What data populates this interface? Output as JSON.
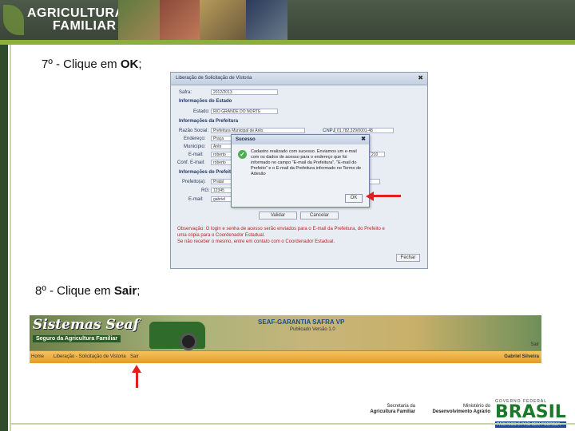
{
  "header": {
    "logo_line1": "AGRICULTURA",
    "logo_line2": "FAMILIAR"
  },
  "steps": [
    {
      "prefix": "7º - Clique em ",
      "action": "OK",
      "suffix": ";"
    },
    {
      "prefix": "8º - Clique em ",
      "action": "Sair",
      "suffix": ";"
    }
  ],
  "screenshot1": {
    "window_title": "Liberação de Solicitação de Vistoria",
    "safra_label": "Safra:",
    "safra_value": "2012/2013",
    "section_estado": "Informações do Estado",
    "estado_label": "Estado:",
    "estado_value": "RIO GRANDE DO NORTE",
    "section_prefeitura": "Informações da Prefeitura",
    "razao_label": "Razão Social:",
    "razao_value": "Prefeitura Municipal de Arês",
    "cnpj_label": "CNPJ:",
    "cnpj_value": "01.782.329/0001-48",
    "endereco_label": "Endereço:",
    "endereco_value": "Praça",
    "municipio_label": "Município:",
    "municipio_value": "Arês",
    "email_label": "E-mail:",
    "email_value": "roberto",
    "fone_value": "210",
    "conf_email_label": "Conf. E-mail:",
    "conf_email_value": "roberto",
    "section_prefeito": "Informações do Prefeito",
    "prefeito_label": "Prefeito(a):",
    "prefeito_value": "Pratal",
    "cpf_suffix": "-9",
    "rg_label": "RG:",
    "rg_value": "12345",
    "prefeito_email_label": "E-mail:",
    "prefeito_email_value": "gabriel",
    "validar": "Validar",
    "cancelar": "Cancelar",
    "obs_line1": "Observação: O login e senha de acesso serão enviados para o E-mail da Prefeitura, do Prefeito e",
    "obs_line2": "uma cópia para o Coordenador Estadual.",
    "obs_line3": "Se não receber o mesmo, entre em contato com o Coordenador Estadual.",
    "fechar": "Fechar",
    "dialog": {
      "title": "Sucesso",
      "message": "Cadastro realizado com sucesso. Enviamos um e-mail com os dados de acesso para o endereço que foi informado no campo \"E-mail da Prefeitura\", \"E-mail do Prefeito\" e o E-mail da Prefeitura informado no Termo de Adesão",
      "ok_label": "OK"
    }
  },
  "screenshot2": {
    "system_title": "Sistemas Seaf",
    "subtitle": "Seguro da Agricultura Familiar",
    "app_title": "SEAF-GARANTIA SAFRA VP",
    "app_subtitle": "Publicado Versão 1.0",
    "top_right": "Sair",
    "nav": [
      "Home",
      "Liberação - Solicitação de Vistoria",
      "Sair"
    ],
    "user": "Gabriel Silveira"
  },
  "footer": {
    "secretaria_line1": "Secretaria da",
    "secretaria_line2": "Agricultura Familiar",
    "ministerio_line1": "Ministério do",
    "ministerio_line2": "Desenvolvimento Agrário",
    "brasil_top": "GOVERNO FEDERAL",
    "brasil_word": "BRASIL",
    "brasil_slogan": "PAÍS RICO É PAÍS SEM POBREZA"
  }
}
